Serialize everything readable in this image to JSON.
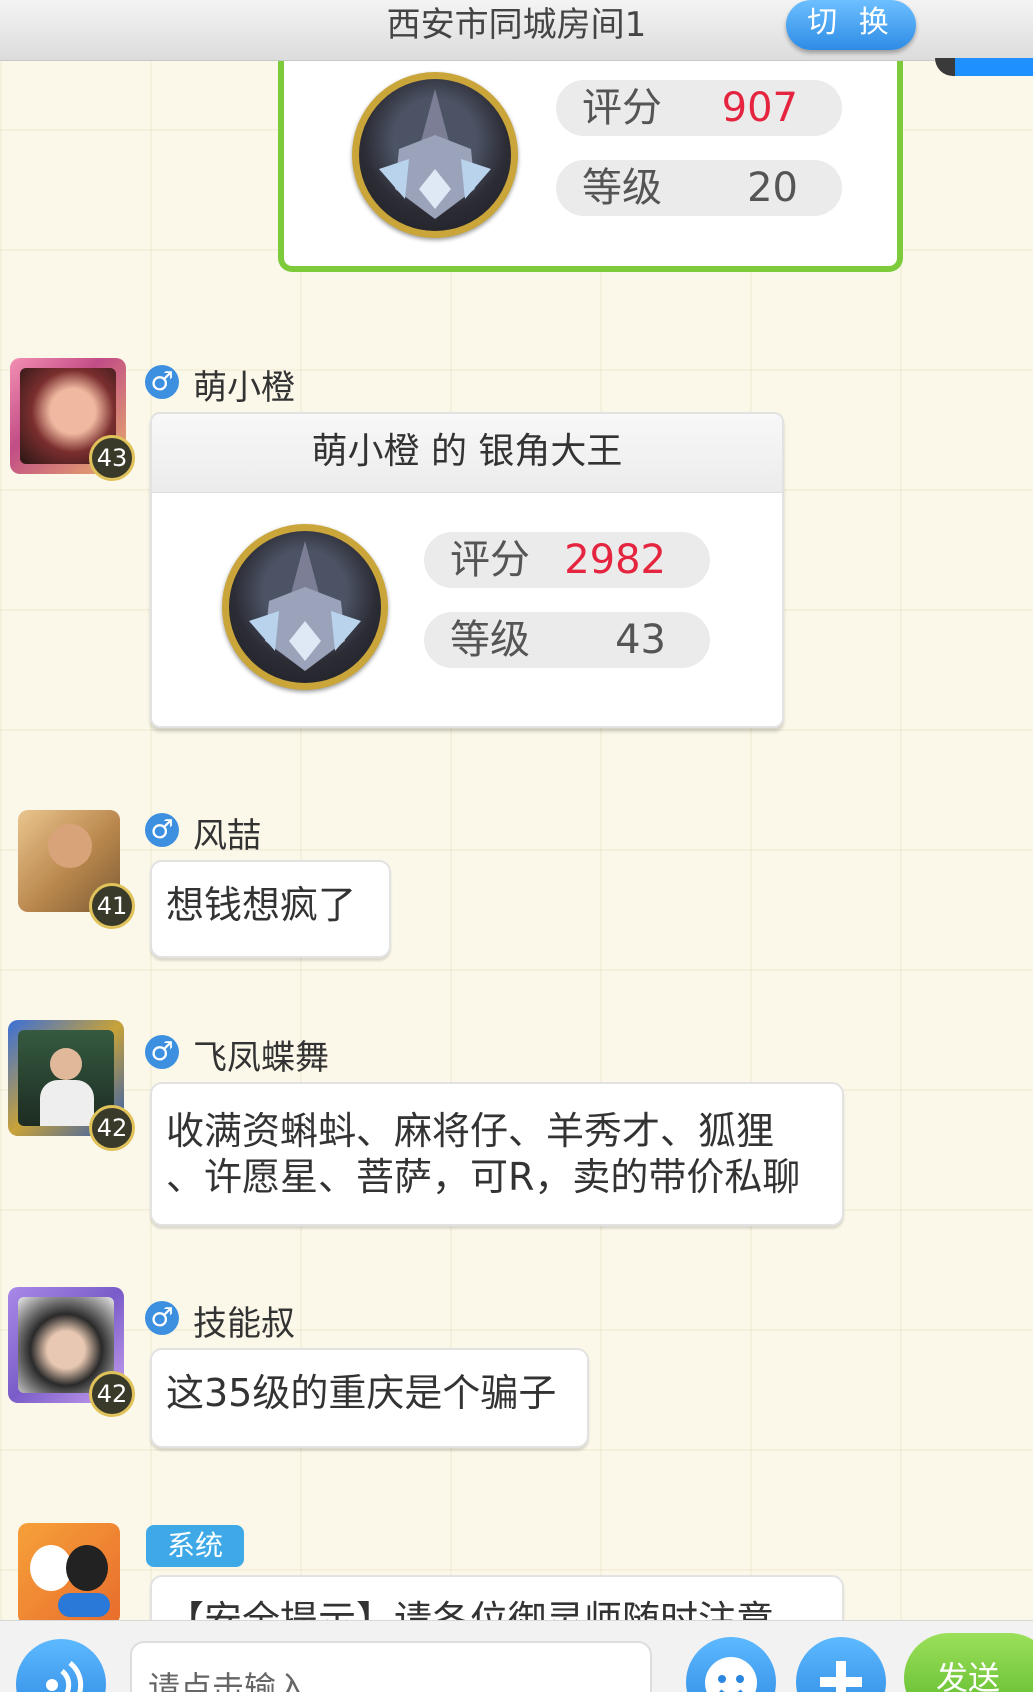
{
  "header": {
    "title": "西安市同城房间1",
    "switch_label": "切 换"
  },
  "top_card": {
    "score_label": "评分",
    "score_value": "907",
    "level_label": "等级",
    "level_value": "20"
  },
  "messages": [
    {
      "username": "萌小橙",
      "level": "43",
      "gender_icon": "♂",
      "card_title": "萌小橙 的 银角大王",
      "score_label": "评分",
      "score_value": "2982",
      "level_label": "等级",
      "level_value": "43"
    },
    {
      "username": "风喆",
      "level": "41",
      "gender_icon": "♂",
      "text": "想钱想疯了"
    },
    {
      "username": "飞凤蝶舞",
      "level": "42",
      "gender_icon": "♂",
      "text_line1": "收满资蝌蚪、麻将仔、羊秀才、狐狸",
      "text_line2": "、许愿星、菩萨，可R，卖的带价私聊"
    },
    {
      "username": "技能叔",
      "level": "42",
      "gender_icon": "♂",
      "text": "这35级的重庆是个骗子"
    },
    {
      "badge": "系统",
      "text": "【安全提示】请各位御灵师随时注意"
    }
  ],
  "input": {
    "placeholder": "请点击输入",
    "send_label": "发送"
  },
  "colors": {
    "accent_blue": "#3d8fe0",
    "card_border_green": "#7dcb3a",
    "score_red": "#e5243f",
    "send_green": "#5cb82a"
  }
}
